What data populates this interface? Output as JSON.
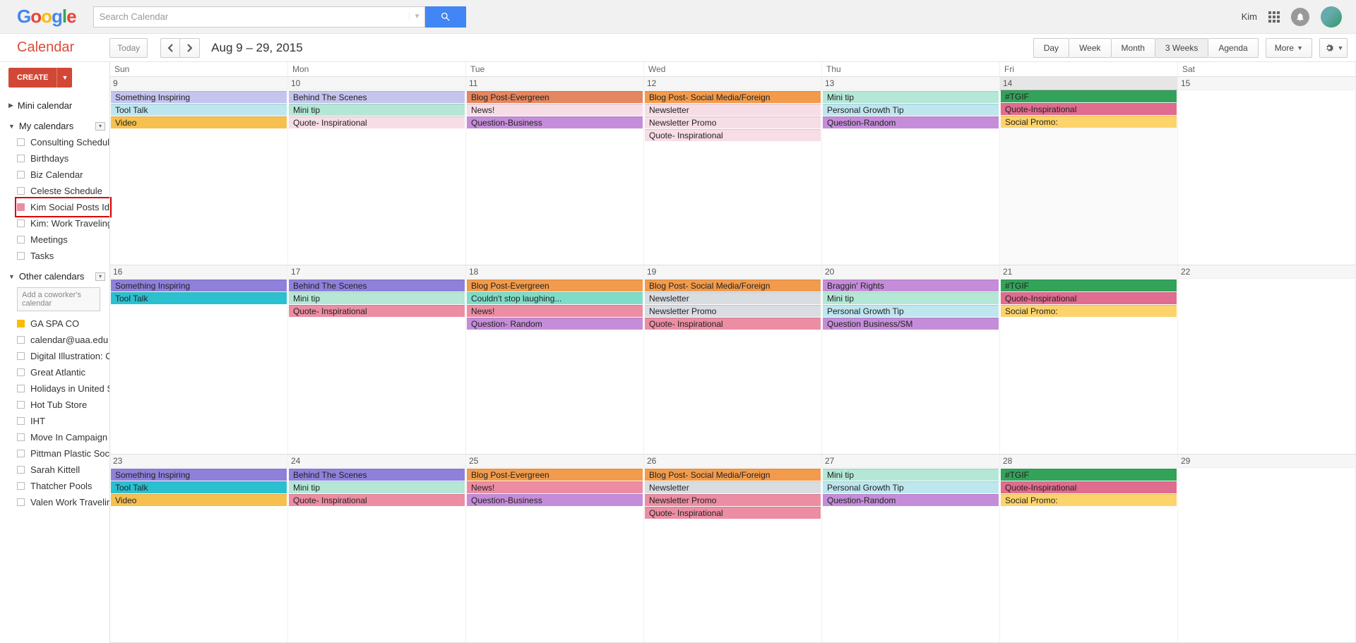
{
  "header": {
    "search_placeholder": "Search Calendar",
    "user_name": "Kim"
  },
  "toolbar": {
    "app_name": "Calendar",
    "today_label": "Today",
    "date_range": "Aug 9 – 29, 2015",
    "views": [
      "Day",
      "Week",
      "Month",
      "3 Weeks",
      "Agenda"
    ],
    "active_view": "3 Weeks",
    "more_label": "More",
    "create_label": "CREATE"
  },
  "sidebar": {
    "mini_label": "Mini calendar",
    "my_cal_label": "My calendars",
    "my_calendars": [
      {
        "name": "Consulting Schedule",
        "color": ""
      },
      {
        "name": "Birthdays",
        "color": ""
      },
      {
        "name": "Biz Calendar",
        "color": ""
      },
      {
        "name": "Celeste Schedule",
        "color": ""
      },
      {
        "name": "Kim Social Posts Ideas",
        "color": "#EC8DA3",
        "highlight": true
      },
      {
        "name": "Kim: Work Traveling …",
        "color": ""
      },
      {
        "name": "Meetings",
        "color": ""
      },
      {
        "name": "Tasks",
        "color": ""
      }
    ],
    "other_cal_label": "Other calendars",
    "add_coworker_placeholder": "Add a coworker's calendar",
    "other_calendars": [
      {
        "name": "GA SPA CO",
        "color": "#FBBC05"
      },
      {
        "name": "calendar@uaa.edu",
        "color": ""
      },
      {
        "name": "Digital Illustration: C…",
        "color": ""
      },
      {
        "name": "Great Atlantic",
        "color": ""
      },
      {
        "name": "Holidays in United St…",
        "color": ""
      },
      {
        "name": "Hot Tub Store",
        "color": ""
      },
      {
        "name": "IHT",
        "color": ""
      },
      {
        "name": "Move In Campaign",
        "color": ""
      },
      {
        "name": "Pittman Plastic Social",
        "color": ""
      },
      {
        "name": "Sarah Kittell",
        "color": ""
      },
      {
        "name": "Thatcher Pools",
        "color": ""
      },
      {
        "name": "Valen Work Travelin…",
        "color": ""
      }
    ]
  },
  "calendar": {
    "dow": [
      "Sun",
      "Mon",
      "Tue",
      "Wed",
      "Thu",
      "Fri",
      "Sat"
    ],
    "colors": {
      "lav": "#C5C4EE",
      "violet": "#8F80DB",
      "mint": "#B4E7D6",
      "sky": "#BEE6EF",
      "teal": "#2BC0CF",
      "amber": "#F6C04F",
      "rosebg": "#F7DDE6",
      "rose": "#EC8DA3",
      "coral": "#E4865F",
      "orange": "#F29B4C",
      "plum": "#C58DD9",
      "aqua": "#7FDCC7",
      "steel": "#D9DDE2",
      "green": "#33A35A",
      "hotpink": "#E06C8F",
      "lemon": "#FCD46B"
    },
    "weeks": [
      {
        "dates": [
          9,
          10,
          11,
          12,
          13,
          14,
          15
        ],
        "today_index": 5,
        "events": [
          [
            {
              "t": "Something Inspiring",
              "c": "lav"
            },
            {
              "t": "Tool Talk",
              "c": "sky"
            },
            {
              "t": "Video",
              "c": "amber"
            }
          ],
          [
            {
              "t": "Behind The Scenes",
              "c": "lav"
            },
            {
              "t": "Mini tip",
              "c": "mint"
            },
            {
              "t": "Quote- Inspirational",
              "c": "rosebg"
            }
          ],
          [
            {
              "t": "Blog Post-Evergreen",
              "c": "coral"
            },
            {
              "t": "News!",
              "c": "rosebg"
            },
            {
              "t": "Question-Business",
              "c": "plum"
            }
          ],
          [
            {
              "t": "Blog Post- Social Media/Foreign",
              "c": "orange"
            },
            {
              "t": "Newsletter",
              "c": "rosebg"
            },
            {
              "t": "Newsletter Promo",
              "c": "rosebg"
            },
            {
              "t": "Quote- Inspirational",
              "c": "rosebg"
            }
          ],
          [
            {
              "t": "Mini tip",
              "c": "mint"
            },
            {
              "t": "Personal Growth Tip",
              "c": "sky"
            },
            {
              "t": "Question-Random",
              "c": "plum"
            }
          ],
          [
            {
              "t": "#TGIF",
              "c": "green"
            },
            {
              "t": "Quote-Inspirational",
              "c": "hotpink"
            },
            {
              "t": "Social Promo:",
              "c": "lemon"
            }
          ],
          []
        ]
      },
      {
        "dates": [
          16,
          17,
          18,
          19,
          20,
          21,
          22
        ],
        "events": [
          [
            {
              "t": "Something Inspiring",
              "c": "violet"
            },
            {
              "t": "Tool Talk",
              "c": "teal"
            }
          ],
          [
            {
              "t": "Behind The Scenes",
              "c": "violet"
            },
            {
              "t": "Mini tip",
              "c": "mint"
            },
            {
              "t": "Quote- Inspirational",
              "c": "rose"
            }
          ],
          [
            {
              "t": "Blog Post-Evergreen",
              "c": "orange"
            },
            {
              "t": "Couldn't stop laughing...",
              "c": "aqua"
            },
            {
              "t": "News!",
              "c": "rose"
            },
            {
              "t": "Question- Random",
              "c": "plum"
            }
          ],
          [
            {
              "t": "Blog Post- Social Media/Foreign",
              "c": "orange"
            },
            {
              "t": "Newsletter",
              "c": "steel"
            },
            {
              "t": "Newsletter Promo",
              "c": "steel"
            },
            {
              "t": "Quote- Inspirational",
              "c": "rose"
            }
          ],
          [
            {
              "t": "Braggin' Rights",
              "c": "plum"
            },
            {
              "t": "Mini tip",
              "c": "mint"
            },
            {
              "t": "Personal Growth Tip",
              "c": "sky"
            },
            {
              "t": "Question Business/SM",
              "c": "plum"
            }
          ],
          [
            {
              "t": "#TGIF",
              "c": "green"
            },
            {
              "t": "Quote-Inspirational",
              "c": "hotpink"
            },
            {
              "t": "Social Promo:",
              "c": "lemon"
            }
          ],
          []
        ]
      },
      {
        "dates": [
          23,
          24,
          25,
          26,
          27,
          28,
          29
        ],
        "events": [
          [
            {
              "t": "Something Inspiring",
              "c": "violet"
            },
            {
              "t": "Tool Talk",
              "c": "teal"
            },
            {
              "t": "Video",
              "c": "amber"
            }
          ],
          [
            {
              "t": "Behind The Scenes",
              "c": "violet"
            },
            {
              "t": "Mini tip",
              "c": "mint"
            },
            {
              "t": "Quote- Inspirational",
              "c": "rose"
            }
          ],
          [
            {
              "t": "Blog Post-Evergreen",
              "c": "orange"
            },
            {
              "t": "News!",
              "c": "rose"
            },
            {
              "t": "Question-Business",
              "c": "plum"
            }
          ],
          [
            {
              "t": "Blog Post- Social Media/Foreign",
              "c": "orange"
            },
            {
              "t": "Newsletter",
              "c": "steel"
            },
            {
              "t": "Newsletter Promo",
              "c": "rose"
            },
            {
              "t": "Quote- Inspirational",
              "c": "rose"
            }
          ],
          [
            {
              "t": "Mini tip",
              "c": "mint"
            },
            {
              "t": "Personal Growth Tip",
              "c": "sky"
            },
            {
              "t": "Question-Random",
              "c": "plum"
            }
          ],
          [
            {
              "t": "#TGIF",
              "c": "green"
            },
            {
              "t": "Quote-Inspirational",
              "c": "hotpink"
            },
            {
              "t": "Social Promo:",
              "c": "lemon"
            }
          ],
          []
        ]
      }
    ]
  }
}
